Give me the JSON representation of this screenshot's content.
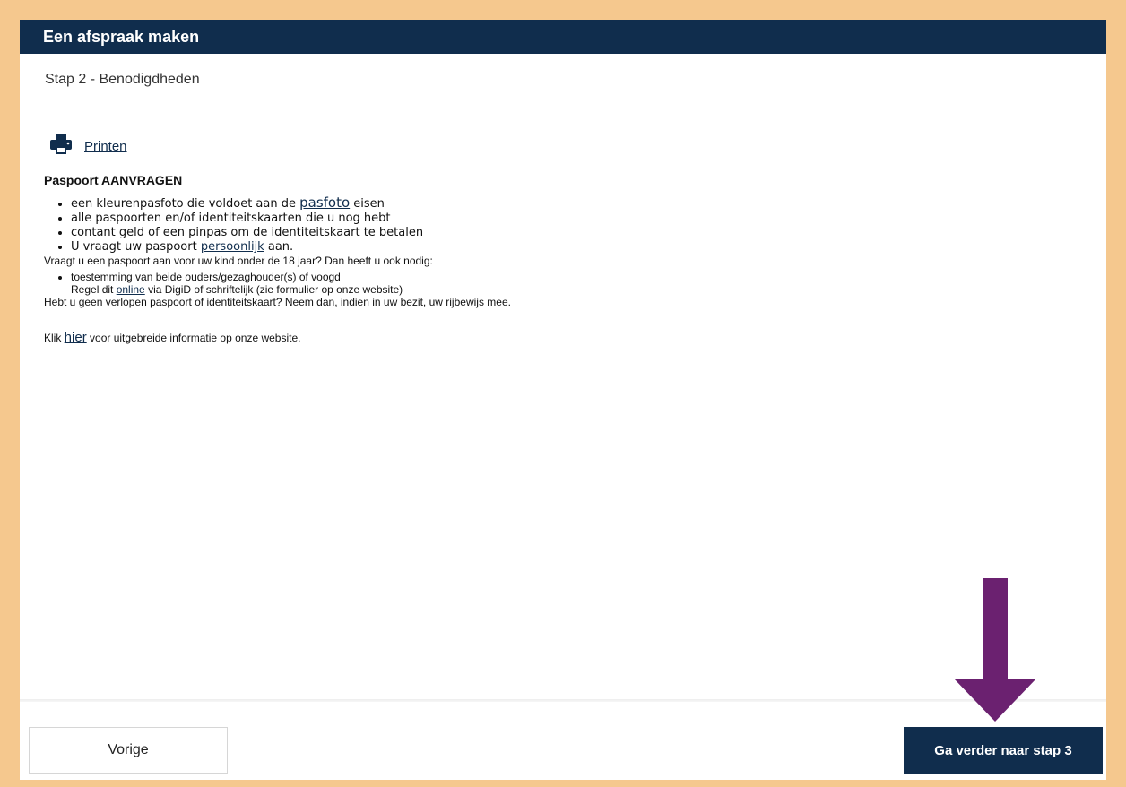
{
  "header": {
    "title": "Een afspraak maken"
  },
  "step": {
    "label": "Stap 2 - Benodigdheden"
  },
  "print": {
    "label": "Printen",
    "icon": "printer-icon"
  },
  "section": {
    "title": "Paspoort AANVRAGEN",
    "items": [
      {
        "before": "een kleurenpasfoto die voldoet aan de ",
        "link": "pasfoto",
        "after": " eisen"
      },
      {
        "text": "alle paspoorten en/of identiteitskaarten die u nog hebt"
      },
      {
        "text": "contant geld of een pinpas om de identiteitskaart te betalen"
      },
      {
        "before": "U vraagt uw paspoort ",
        "link": "persoonlijk",
        "after": " aan."
      }
    ],
    "child_question": "Vraagt u een paspoort aan voor uw kind onder de 18 jaar? Dan heeft u ook nodig:",
    "child_item": {
      "line1": "toestemming van beide ouders/gezaghouder(s) of voogd",
      "line2_before": "Regel dit ",
      "line2_link": "online",
      "line2_after": " via DigiD of schriftelijk (zie formulier op onze website)"
    },
    "no_expired": "Hebt u geen verlopen paspoort of identiteitskaart? Neem dan, indien in uw bezit, uw rijbewijs mee.",
    "more_info": {
      "before": "Klik ",
      "link": "hier",
      "after": " voor uitgebreide informatie op onze website."
    }
  },
  "footer": {
    "prev_label": "Vorige",
    "next_label": "Ga verder naar stap 3"
  },
  "colors": {
    "brand": "#102d4d",
    "frame": "#f5c88e",
    "annotation_arrow": "#6b2170"
  }
}
